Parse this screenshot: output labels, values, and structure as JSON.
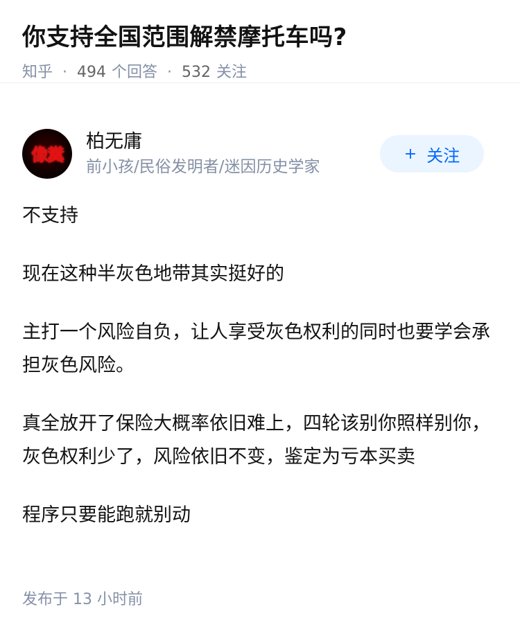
{
  "question": {
    "title": "你支持全国范围解禁摩托车吗?",
    "source": "知乎",
    "answer_count": "494",
    "answer_label": "个回答",
    "follower_count": "532",
    "follower_label": "关注"
  },
  "author": {
    "avatar_text": "像糞",
    "name": "柏无庸",
    "bio": "前小孩/民俗发明者/迷因历史学家"
  },
  "follow_button": {
    "plus": "+",
    "label": "关注"
  },
  "answer": {
    "paragraphs": [
      "不支持",
      "现在这种半灰色地带其实挺好的",
      "主打一个风险自负，让人享受灰色权利的同时也要学会承担灰色风险。",
      "真全放开了保险大概率依旧难上，四轮该别你照样别你，灰色权利少了，风险依旧不变，鉴定为亏本买卖",
      "程序只要能跑就别动"
    ],
    "published_label": "发布于",
    "published_time": "13 小时前"
  },
  "colors": {
    "text_primary": "#121212",
    "text_secondary": "#8590a6",
    "accent": "#0066ff",
    "follow_bg": "#ebf5ff"
  }
}
